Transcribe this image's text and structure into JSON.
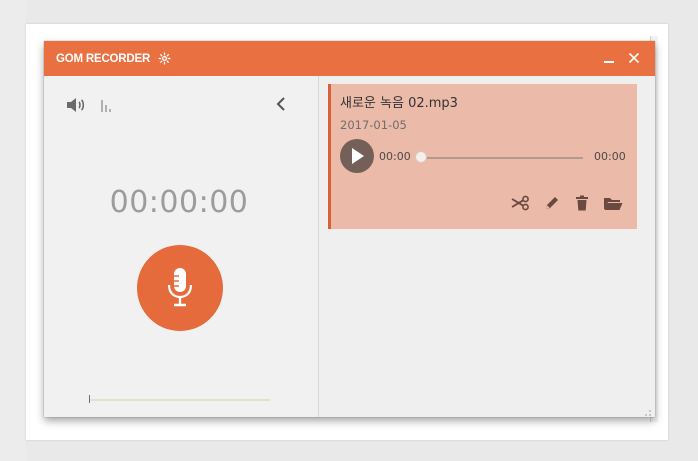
{
  "app": {
    "title": "GOM RECORDER"
  },
  "recorder": {
    "timer": "00:00:00"
  },
  "recording": {
    "title": "새로운 녹음 02.mp3",
    "date": "2017-01-05",
    "current_time": "00:00",
    "total_time": "00:00",
    "progress": 0
  },
  "colors": {
    "accent": "#e97041",
    "record_button": "#e56b3c",
    "selected_item": "#ebbaa9",
    "play_button": "#746058"
  },
  "icons": {
    "settings": "gear-icon",
    "minimize": "minimize-icon",
    "close": "close-icon",
    "volume": "speaker-icon",
    "level": "level-bars-icon",
    "back": "chevron-left-icon",
    "record": "microphone-icon",
    "play": "play-icon",
    "cut": "scissors-icon",
    "edit": "pencil-icon",
    "delete": "trash-icon",
    "open_folder": "folder-open-icon"
  }
}
